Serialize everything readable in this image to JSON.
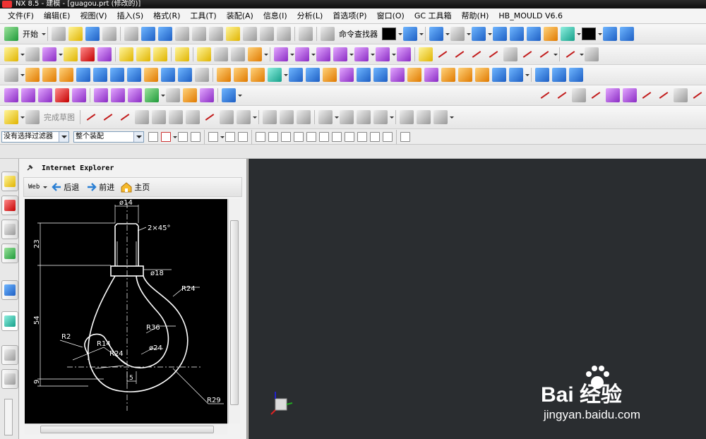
{
  "window": {
    "title": "NX 8.5 - 建模 - [guagou.prt (修改的)]"
  },
  "menu": [
    "文件(F)",
    "编辑(E)",
    "视图(V)",
    "插入(S)",
    "格式(R)",
    "工具(T)",
    "装配(A)",
    "信息(I)",
    "分析(L)",
    "首选项(P)",
    "窗口(O)",
    "GC 工具箱",
    "帮助(H)",
    "HB_MOULD V6.6"
  ],
  "toolbar": {
    "start_label": "开始",
    "command_finder_label": "命令查找器",
    "finish_sketch_label": "完成草图",
    "color_swatch": "#000000"
  },
  "filterbar": {
    "selection_filter": "没有选择过滤器",
    "scope": "整个装配"
  },
  "panel": {
    "title": "Internet Explorer",
    "web_label": "Web",
    "back_label": "后退",
    "forward_label": "前进",
    "home_label": "主页"
  },
  "drawing": {
    "dims": [
      "ø14",
      "2×45°",
      "ø18",
      "R24",
      "R36",
      "ø24",
      "R2",
      "R14",
      "R24",
      "R29",
      "23",
      "54",
      "9",
      "5"
    ]
  },
  "watermark": {
    "brand": "Bai 经验",
    "url": "jingyan.baidu.com"
  },
  "colors": {
    "canvas": "#2a2d30",
    "cad_line": "#ffffff",
    "viewer_bg": "#000000"
  }
}
